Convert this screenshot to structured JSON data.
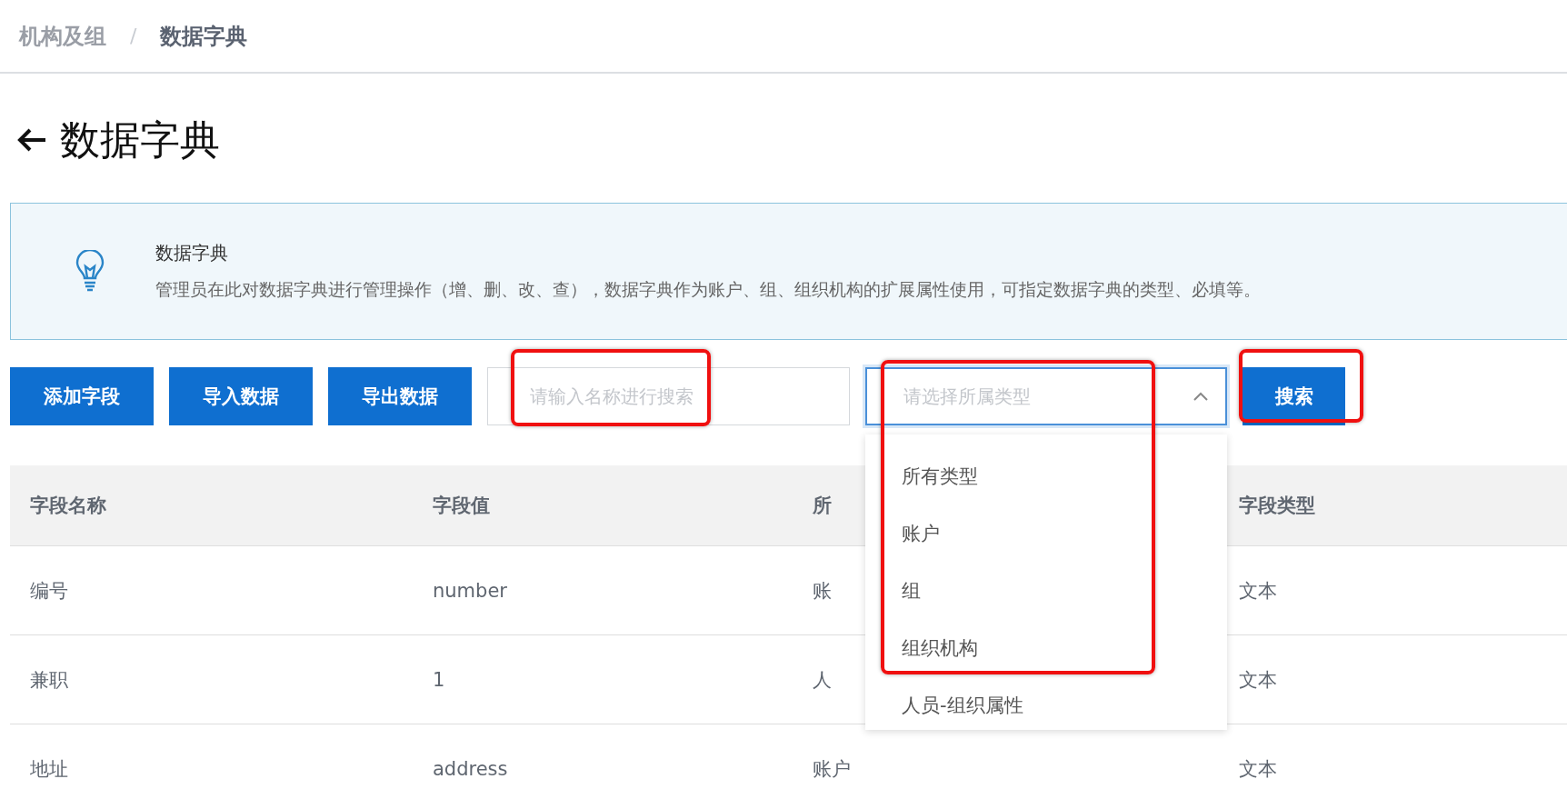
{
  "breadcrumb": {
    "separator": "/",
    "items": [
      {
        "label": "机构及组",
        "current": false
      },
      {
        "label": "数据字典",
        "current": true
      }
    ]
  },
  "page_title": "数据字典",
  "alert": {
    "title": "数据字典",
    "description": "管理员在此对数据字典进行管理操作（增、删、改、查），数据字典作为账户、组、组织机构的扩展属性使用，可指定数据字典的类型、必填等。"
  },
  "toolbar": {
    "buttons": [
      "添加字段",
      "导入数据",
      "导出数据"
    ],
    "search_input": {
      "placeholder": "请输入名称进行搜索",
      "highlighted": true
    },
    "type_select": {
      "placeholder": "请选择所属类型",
      "expanded": true,
      "highlighted": true,
      "options": [
        "所有类型",
        "账户",
        "组",
        "组织机构",
        "人员-组织属性"
      ]
    },
    "search_button": {
      "label": "搜索",
      "highlighted": true
    }
  },
  "table": {
    "columns": [
      "字段名称",
      "字段值",
      "所",
      "字段类型"
    ],
    "rows": [
      [
        "编号",
        "number",
        "账",
        "文本"
      ],
      [
        "兼职",
        "1",
        "人",
        "文本"
      ],
      [
        "地址",
        "address",
        "账户",
        "文本"
      ]
    ]
  }
}
